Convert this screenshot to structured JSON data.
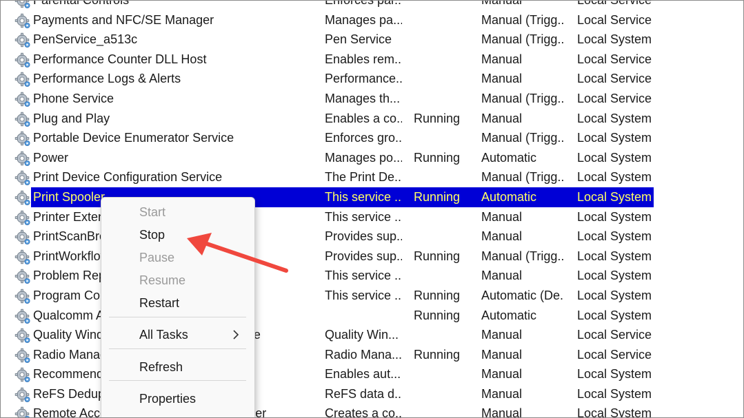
{
  "services": [
    {
      "name": "Parental Controls",
      "description": "Enforces par...",
      "status": "",
      "startup": "Manual",
      "logon": "Local Service"
    },
    {
      "name": "Payments and NFC/SE Manager",
      "description": "Manages pa...",
      "status": "",
      "startup": "Manual (Trigg...",
      "logon": "Local Service"
    },
    {
      "name": "PenService_a513c",
      "description": "Pen Service",
      "status": "",
      "startup": "Manual (Trigg...",
      "logon": "Local System"
    },
    {
      "name": "Performance Counter DLL Host",
      "description": "Enables rem...",
      "status": "",
      "startup": "Manual",
      "logon": "Local Service"
    },
    {
      "name": "Performance Logs & Alerts",
      "description": "Performance...",
      "status": "",
      "startup": "Manual",
      "logon": "Local Service"
    },
    {
      "name": "Phone Service",
      "description": "Manages th...",
      "status": "",
      "startup": "Manual (Trigg...",
      "logon": "Local Service"
    },
    {
      "name": "Plug and Play",
      "description": "Enables a co...",
      "status": "Running",
      "startup": "Manual",
      "logon": "Local System"
    },
    {
      "name": "Portable Device Enumerator Service",
      "description": "Enforces gro...",
      "status": "",
      "startup": "Manual (Trigg...",
      "logon": "Local System"
    },
    {
      "name": "Power",
      "description": "Manages po...",
      "status": "Running",
      "startup": "Automatic",
      "logon": "Local System"
    },
    {
      "name": "Print Device Configuration Service",
      "description": "The Print De...",
      "status": "",
      "startup": "Manual (Trigg...",
      "logon": "Local System"
    },
    {
      "name": "Print Spooler",
      "description": "This service ...",
      "status": "Running",
      "startup": "Automatic",
      "logon": "Local System"
    },
    {
      "name": "Printer Extensions and Notifications",
      "description": "This service ...",
      "status": "",
      "startup": "Manual",
      "logon": "Local System"
    },
    {
      "name": "PrintScanBrokerService",
      "description": "Provides sup...",
      "status": "",
      "startup": "Manual",
      "logon": "Local System"
    },
    {
      "name": "PrintWorkflowUserSvc_a513c",
      "description": "Provides sup...",
      "status": "Running",
      "startup": "Manual (Trigg...",
      "logon": "Local System"
    },
    {
      "name": "Problem Reports Control Panel Support",
      "description": "This service ...",
      "status": "",
      "startup": "Manual",
      "logon": "Local System"
    },
    {
      "name": "Program Compatibility Assistant Service",
      "description": "This service ...",
      "status": "Running",
      "startup": "Automatic (De...",
      "logon": "Local System"
    },
    {
      "name": "Qualcomm Atheros Service",
      "description": "",
      "status": "Running",
      "startup": "Automatic",
      "logon": "Local System"
    },
    {
      "name": "Quality Windows Audio Video Experience",
      "description": "Quality Win...",
      "status": "",
      "startup": "Manual",
      "logon": "Local Service"
    },
    {
      "name": "Radio Management Service",
      "description": "Radio Mana...",
      "status": "Running",
      "startup": "Manual",
      "logon": "Local Service"
    },
    {
      "name": "Recommended Troubleshooting Service",
      "description": "Enables aut...",
      "status": "",
      "startup": "Manual",
      "logon": "Local System"
    },
    {
      "name": "ReFS Dedup Service",
      "description": "ReFS data d...",
      "status": "",
      "startup": "Manual",
      "logon": "Local System"
    },
    {
      "name": "Remote Access Auto Connection Manager",
      "description": "Creates a co...",
      "status": "",
      "startup": "Manual",
      "logon": "Local System"
    }
  ],
  "selected_service": "Print Spooler",
  "context_menu": {
    "start": "Start",
    "stop": "Stop",
    "pause": "Pause",
    "resume": "Resume",
    "restart": "Restart",
    "all_tasks": "All Tasks",
    "refresh": "Refresh",
    "properties": "Properties"
  },
  "colors": {
    "selection_bg": "#0000d6",
    "selection_text": "#ffff66",
    "annotation_arrow": "#f0483e"
  },
  "icons": {
    "service_icon": "gear-icon",
    "submenu_icon": "chevron-right-icon"
  }
}
